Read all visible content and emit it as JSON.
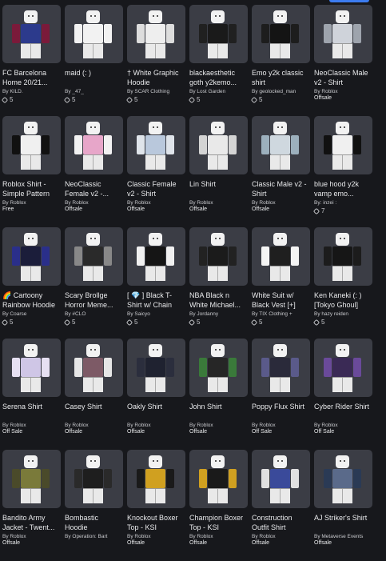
{
  "items": [
    {
      "title": "FC Barcelona Home 20/21...",
      "creator": "By KILD.",
      "price": "5",
      "status": "",
      "torso": "#2c3a8c",
      "arm": "#7a1a3a"
    },
    {
      "title": "maid (: )",
      "creator": "By _47_",
      "price": "5",
      "status": "",
      "torso": "#f2f2f2",
      "arm": "#f2f2f2"
    },
    {
      "title": "† White Graphic Hoodie",
      "creator": "By SCAR Clothing",
      "price": "5",
      "status": "",
      "torso": "#eeeeee",
      "arm": "#dddddd"
    },
    {
      "title": "blackaesthetic goth y2kemo...",
      "creator": "By Lost Garden",
      "price": "5",
      "status": "",
      "torso": "#1a1a1a",
      "arm": "#202020"
    },
    {
      "title": "Emo y2k classic shirt",
      "creator": "By geolocked_man",
      "price": "5",
      "status": "",
      "torso": "#141414",
      "arm": "#1d1d1d"
    },
    {
      "title": "NeoClassic Male v2 - Shirt",
      "creator": "By Roblox",
      "price": "",
      "status": "Offsale",
      "torso": "#cfd3da",
      "arm": "#9ea4ad"
    },
    {
      "title": "Roblox Shirt - Simple Pattern",
      "creator": "By Roblox",
      "price": "",
      "status": "Free",
      "torso": "#f0f0f0",
      "arm": "#111111"
    },
    {
      "title": "NeoClassic Female v2 -...",
      "creator": "By Roblox",
      "price": "",
      "status": "Offsale",
      "torso": "#e7a6c9",
      "arm": "#f2f2f2"
    },
    {
      "title": "Classic Female v2 - Shirt",
      "creator": "By Roblox",
      "price": "",
      "status": "Offsale",
      "torso": "#b9c8dc",
      "arm": "#dfe4ea"
    },
    {
      "title": "Lin Shirt",
      "creator": "By Roblox",
      "price": "",
      "status": "Offsale",
      "torso": "#e9e9e9",
      "arm": "#d4d4d4"
    },
    {
      "title": "Classic Male v2 - Shirt",
      "creator": "By Roblox",
      "price": "",
      "status": "Offsale",
      "torso": "#cfd8df",
      "arm": "#9cb0bd"
    },
    {
      "title": "blue hood y2k vamp emo...",
      "creator": "By: inzei :",
      "price": "7",
      "status": "",
      "torso": "#f0f0f0",
      "arm": "#111111"
    },
    {
      "title": "🌈 Cartoony Rainbow Hoodie",
      "creator": "By Coarse",
      "price": "5",
      "status": "",
      "torso": "#1b1d3a",
      "arm": "#2a2f8a"
    },
    {
      "title": "Scary Brollge Horror Meme...",
      "creator": "By #CLO",
      "price": "5",
      "status": "",
      "torso": "#2a2a2a",
      "arm": "#888888"
    },
    {
      "title": "[ 💎 ] Black T-Shirt w/ Chain",
      "creator": "By Saicyo",
      "price": "5",
      "status": "",
      "torso": "#151515",
      "arm": "#f0f0f0"
    },
    {
      "title": "NBA Black n White Michael...",
      "creator": "By Jordanny",
      "price": "5",
      "status": "",
      "torso": "#1b1b1b",
      "arm": "#222222"
    },
    {
      "title": "White Suit w/ Black Vest [+]",
      "creator": "By TIX Clothing +",
      "price": "5",
      "status": "",
      "torso": "#1f1f1f",
      "arm": "#f4f4f4"
    },
    {
      "title": "Ken Kaneki (: ) [Tokyo Ghoul]",
      "creator": "By hazy reiden",
      "price": "5",
      "status": "",
      "torso": "#161616",
      "arm": "#1c1c1c"
    },
    {
      "title": "Serena Shirt",
      "creator": "By Roblox",
      "price": "",
      "status": "Off Sale",
      "torso": "#cfc6e6",
      "arm": "#e6e0f2"
    },
    {
      "title": "Casey Shirt",
      "creator": "By Roblox",
      "price": "",
      "status": "Offsale",
      "torso": "#7d5a66",
      "arm": "#e6e6e6"
    },
    {
      "title": "Oakly Shirt",
      "creator": "By Roblox",
      "price": "",
      "status": "Offsale",
      "torso": "#1f2230",
      "arm": "#2b2e3d"
    },
    {
      "title": "John Shirt",
      "creator": "By Roblox",
      "price": "",
      "status": "Offsale",
      "torso": "#262626",
      "arm": "#3a7a3a"
    },
    {
      "title": "Poppy Flux Shirt",
      "creator": "By Roblox",
      "price": "",
      "status": "Off Sale",
      "torso": "#2a2a3a",
      "arm": "#5a5a8a"
    },
    {
      "title": "Cyber Rider Shirt",
      "creator": "By Roblox",
      "price": "",
      "status": "Off Sale",
      "torso": "#3a2a55",
      "arm": "#6a4a9a"
    },
    {
      "title": "Bandito Army Jacket - Twent...",
      "creator": "By Roblox",
      "price": "",
      "status": "Offsale",
      "torso": "#7a7a3a",
      "arm": "#4a4a2a"
    },
    {
      "title": "Bombastic Hoodie",
      "creator": "By Operation: Bart",
      "price": "",
      "status": "",
      "torso": "#1e1e1e",
      "arm": "#2a2a2a"
    },
    {
      "title": "Knockout Boxer Top - KSI",
      "creator": "By Roblox",
      "price": "",
      "status": "Offsale",
      "torso": "#d0a020",
      "arm": "#1a1a1a"
    },
    {
      "title": "Champion Boxer Top - KSI",
      "creator": "By Roblox",
      "price": "",
      "status": "Offsale",
      "torso": "#1a1a1a",
      "arm": "#d0a020"
    },
    {
      "title": "Construction Outfit Shirt",
      "creator": "By Roblox",
      "price": "",
      "status": "Offsale",
      "torso": "#3a4a9a",
      "arm": "#e0e0e0"
    },
    {
      "title": "AJ Striker's Shirt",
      "creator": "By Metaverse Events",
      "price": "",
      "status": "Offsale",
      "torso": "#5a6a8a",
      "arm": "#2a3a55"
    }
  ]
}
